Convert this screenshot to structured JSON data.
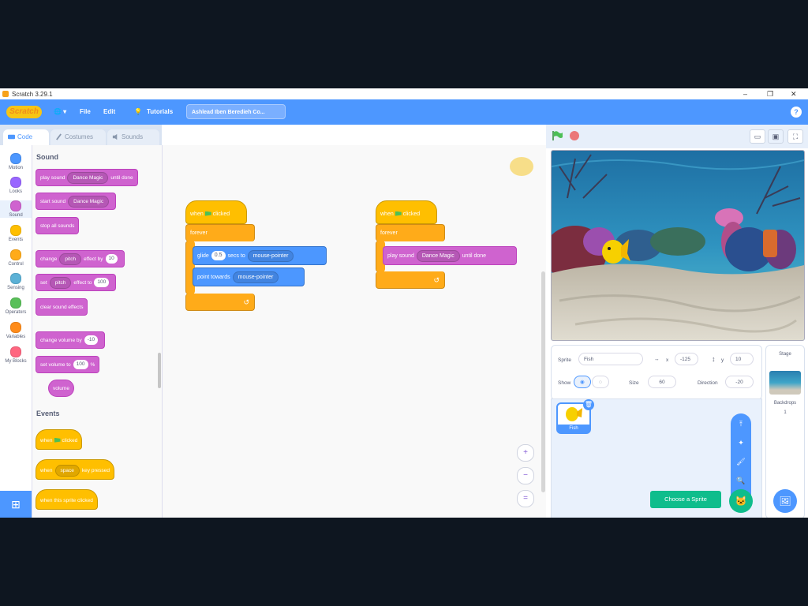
{
  "window": {
    "title": "Scratch 3.29.1",
    "min": "–",
    "max": "❐",
    "close": "✕"
  },
  "menu": {
    "logo": "Scratch",
    "globe": "🌐 ▾",
    "file": "File",
    "edit": "Edit",
    "tutorials": "Tutorials",
    "project_title": "Ashlead Iben Beredieh Co...",
    "help": "?"
  },
  "tabs": {
    "code": "Code",
    "costumes": "Costumes",
    "sounds": "Sounds"
  },
  "categories": [
    {
      "label": "Motion",
      "color": "#4c97ff"
    },
    {
      "label": "Looks",
      "color": "#9966ff"
    },
    {
      "label": "Sound",
      "color": "#cf63cf"
    },
    {
      "label": "Events",
      "color": "#ffbf00"
    },
    {
      "label": "Control",
      "color": "#ffab19"
    },
    {
      "label": "Sensing",
      "color": "#5cb1d6"
    },
    {
      "label": "Operators",
      "color": "#59c059"
    },
    {
      "label": "Variables",
      "color": "#ff8c1a"
    },
    {
      "label": "My Blocks",
      "color": "#ff6680"
    }
  ],
  "palette": {
    "sound_heading": "Sound",
    "play_until_done": {
      "a": "play sound",
      "dd": "Dance Magic",
      "b": "until done"
    },
    "start_sound": {
      "a": "start sound",
      "dd": "Dance Magic"
    },
    "stop_all": "stop all sounds",
    "change_effect": {
      "a": "change",
      "dd": "pitch",
      "b": "effect by",
      "v": "10"
    },
    "set_effect": {
      "a": "set",
      "dd": "pitch",
      "b": "effect to",
      "v": "100"
    },
    "clear_effects": "clear sound effects",
    "change_volume": {
      "a": "change volume by",
      "v": "-10"
    },
    "set_volume": {
      "a": "set volume to",
      "v": "100",
      "b": "%"
    },
    "volume": "volume",
    "events_heading": "Events",
    "when_flag": {
      "a": "when",
      "b": "clicked"
    },
    "when_key": {
      "a": "when",
      "dd": "space",
      "b": "key pressed"
    },
    "when_sprite": "when this sprite clicked"
  },
  "script1": {
    "hat": {
      "a": "when",
      "b": "clicked"
    },
    "forever": "forever",
    "glide": {
      "a": "glide",
      "v": "0.5",
      "b": "secs to",
      "dd": "mouse-pointer"
    },
    "point": {
      "a": "point towards",
      "dd": "mouse-pointer"
    },
    "loop_arrow": "↺"
  },
  "script2": {
    "hat": {
      "a": "when",
      "b": "clicked"
    },
    "forever": "forever",
    "play": {
      "a": "play sound",
      "dd": "Dance Magic",
      "b": "until done"
    },
    "loop_arrow": "↺"
  },
  "zoom": {
    "in": "+",
    "out": "−",
    "reset": "="
  },
  "stage_controls": {
    "small": "▭",
    "large": "▣",
    "full": "⛶"
  },
  "sprite_info": {
    "sprite_label": "Sprite",
    "sprite_name": "Fish",
    "x_label": "x",
    "x": "-125",
    "y_label": "y",
    "y": "10",
    "show_label": "Show",
    "size_label": "Size",
    "size": "60",
    "direction_label": "Direction",
    "direction": "-20"
  },
  "sprites": [
    {
      "name": "Fish"
    }
  ],
  "stage_panel": {
    "title": "Stage",
    "backdrops_label": "Backdrops",
    "backdrops_count": "1"
  },
  "choose_sprite_tooltip": "Choose a Sprite",
  "icons": {
    "cat": "🐱",
    "paint": "🖌",
    "search": "🔍",
    "upload": "⤒",
    "surprise": "✦",
    "backdrop": "🖼"
  }
}
